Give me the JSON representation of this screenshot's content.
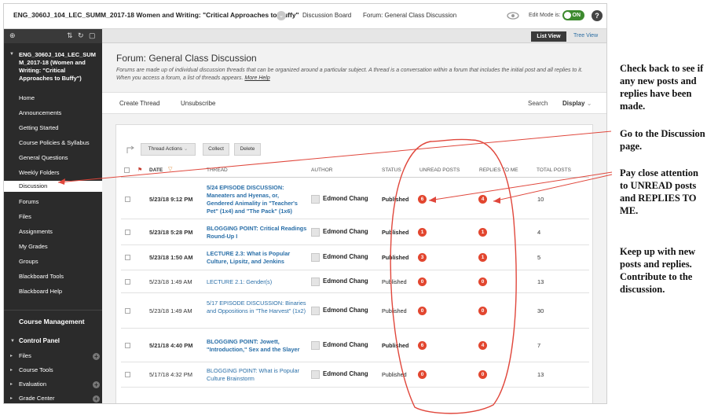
{
  "topbar": {
    "course_title": "ENG_3060J_104_LEC_SUMM_2017-18 Women and Writing: \"Critical Approaches to Buffy\"",
    "crumb_discussion": "Discussion Board",
    "crumb_forum": "Forum: General Class Discussion",
    "edit_mode_label": "Edit Mode is:",
    "edit_mode_value": "ON",
    "help_symbol": "?",
    "icons": [
      "eye-icon",
      "help-icon"
    ]
  },
  "sidebar": {
    "course_menu_title": "ENG_3060J_104_LEC_SUM M_2017-18 (Women and Writing: \"Critical Approaches to Buffy\")",
    "items": [
      {
        "label": "Home"
      },
      {
        "label": "Announcements"
      },
      {
        "label": "Getting Started"
      },
      {
        "label": "Course Policies & Syllabus"
      },
      {
        "label": "General Questions"
      },
      {
        "label": "Weekly Folders"
      },
      {
        "label": "Discussion",
        "active": true
      },
      {
        "label": "Forums"
      },
      {
        "label": "Files"
      },
      {
        "label": "Assignments"
      },
      {
        "label": "My Grades"
      },
      {
        "label": "Groups"
      },
      {
        "label": "Blackboard Tools"
      },
      {
        "label": "Blackboard Help"
      }
    ],
    "course_management": "Course Management",
    "control_panel": "Control Panel",
    "control_items": [
      {
        "label": "Files"
      },
      {
        "label": "Course Tools"
      },
      {
        "label": "Evaluation"
      },
      {
        "label": "Grade Center"
      }
    ]
  },
  "main": {
    "list_view": "List View",
    "tree_view": "Tree View",
    "forum_title": "Forum: General Class Discussion",
    "forum_description": "Forums are made up of individual discussion threads that can be organized around a particular subject. A thread is a conversation within a forum that includes the initial post and all replies to it. When you access a forum, a list of threads appears.",
    "more_help": "More Help",
    "create_thread": "Create Thread",
    "unsubscribe": "Unsubscribe",
    "search": "Search",
    "display": "Display"
  },
  "grid": {
    "buttons": {
      "thread_actions": "Thread Actions",
      "collect": "Collect",
      "delete": "Delete"
    },
    "headers": {
      "date": "DATE",
      "thread": "THREAD",
      "author": "AUTHOR",
      "status": "STATUS",
      "unread": "UNREAD POSTS",
      "replies": "REPLIES TO ME",
      "total": "TOTAL POSTS"
    },
    "rows": [
      {
        "date": "5/23/18 9:12 PM",
        "title": "5/24 EPISODE DISCUSSION: Maneaters and Hyenas, or, Gendered Animality in \"Teacher's Pet\" (1x4) and \"The Pack\" (1x6)",
        "author": "Edmond Chang",
        "status": "Published",
        "unread": "6",
        "replies": "4",
        "total": "10",
        "bold": true
      },
      {
        "date": "5/23/18 5:28 PM",
        "title": "BLOGGING POINT: Critical Readings Round-Up I",
        "author": "Edmond Chang",
        "status": "Published",
        "unread": "1",
        "replies": "1",
        "total": "4",
        "bold": true
      },
      {
        "date": "5/23/18 1:50 AM",
        "title": "LECTURE 2.3: What is Popular Culture, Lipsitz, and Jenkins",
        "author": "Edmond Chang",
        "status": "Published",
        "unread": "3",
        "replies": "1",
        "total": "5",
        "bold": true
      },
      {
        "date": "5/23/18 1:49 AM",
        "title": "LECTURE 2.1: Gender(s)",
        "author": "Edmond Chang",
        "status": "Published",
        "unread": "0",
        "replies": "0",
        "total": "13",
        "bold": false
      },
      {
        "date": "5/23/18 1:49 AM",
        "title": "5/17 EPISODE DISCUSSION: Binaries and Oppositions in \"The Harvest\" (1x2)",
        "author": "Edmond Chang",
        "status": "Published",
        "unread": "0",
        "replies": "0",
        "total": "30",
        "bold": false
      },
      {
        "date": "5/21/18 4:40 PM",
        "title": "BLOGGING POINT: Jowett, \"Introduction,\" Sex and the Slayer",
        "author": "Edmond Chang",
        "status": "Published",
        "unread": "6",
        "replies": "4",
        "total": "7",
        "bold": true
      },
      {
        "date": "5/17/18 4:32 PM",
        "title": "BLOGGING POINT: What is Popular Culture Brainstorm",
        "author": "Edmond Chang",
        "status": "Published",
        "unread": "0",
        "replies": "0",
        "total": "13",
        "bold": false
      }
    ]
  },
  "annotations": {
    "note_1": "Check back to see if any new posts and replies have been made.",
    "note_2": "Go to the Discussion page.",
    "note_3": "Pay close attention to UNREAD posts and REPLIES TO ME.",
    "note_4": "Keep up with new posts and replies. Contribute to the discussion.",
    "ink_color": "#e0473c"
  },
  "colors": {
    "sidebar_bg": "#2b2b2b",
    "link": "#2a6fa8",
    "bubble": "#e2462f",
    "toggle_on": "#3d8a2e"
  }
}
